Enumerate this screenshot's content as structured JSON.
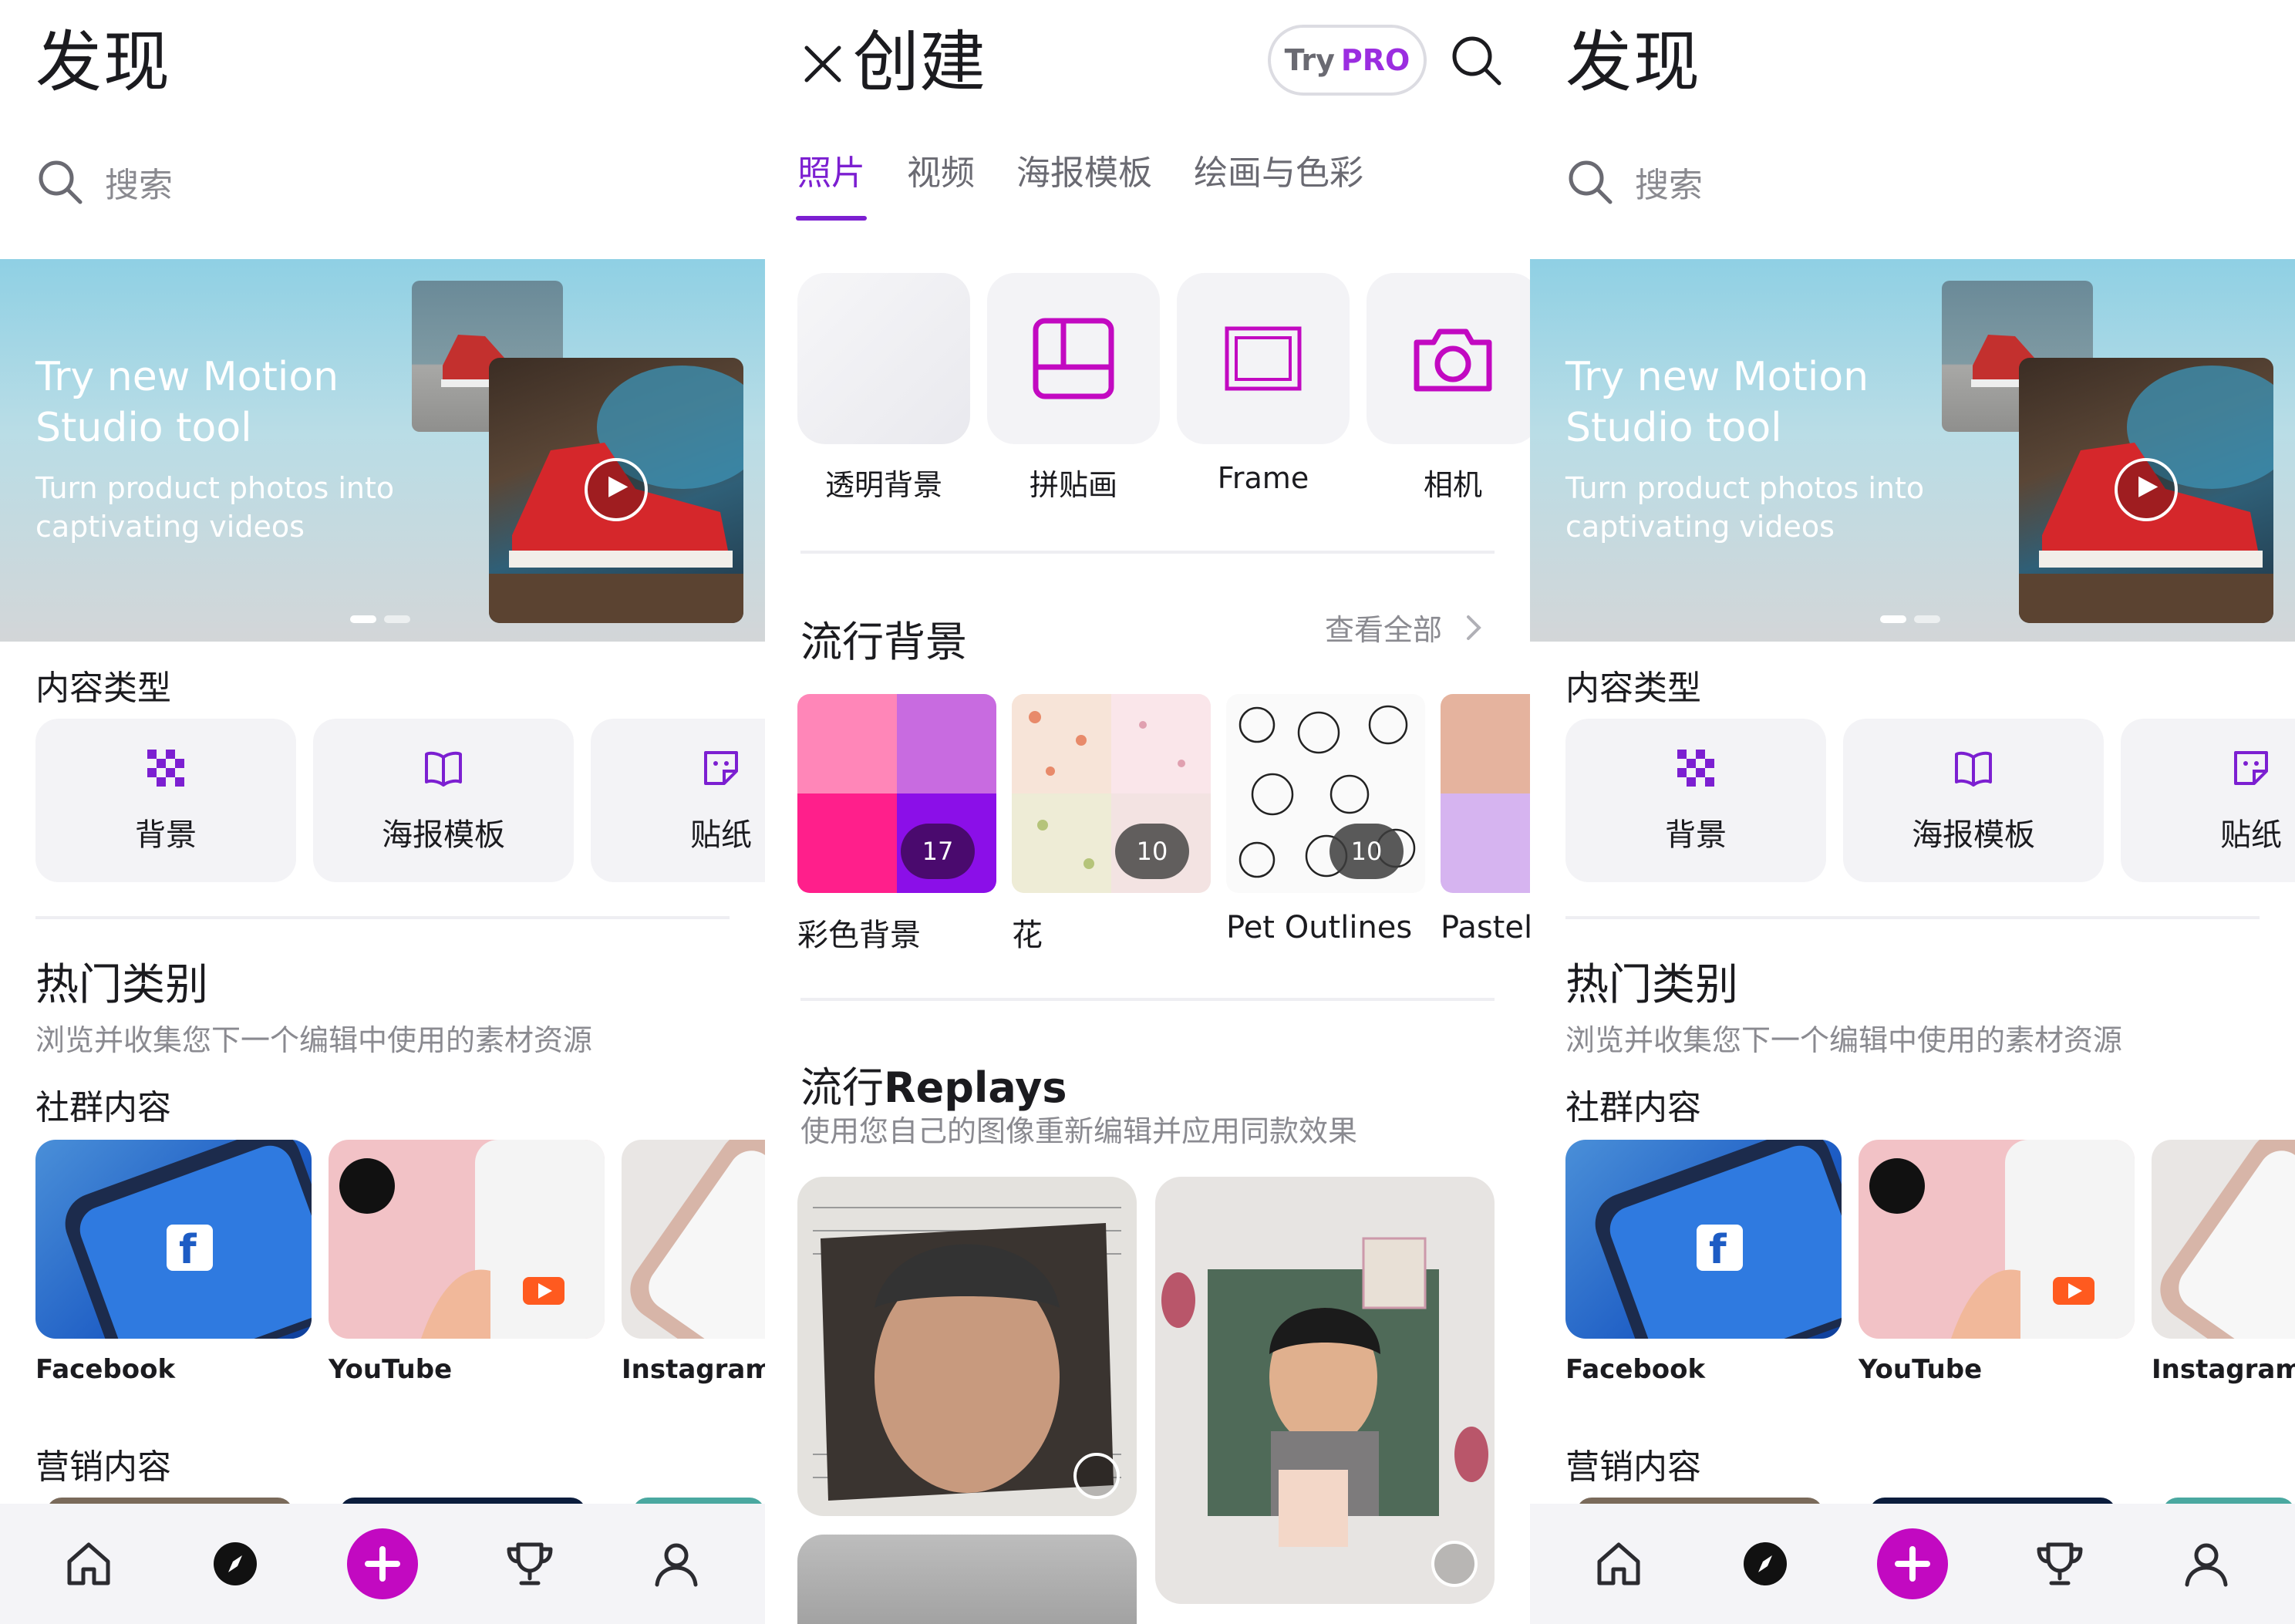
{
  "discover": {
    "title": "发现",
    "search_placeholder": "搜索",
    "banner": {
      "headline": "Try new Motion Studio tool",
      "subtitle": "Turn product photos into captivating videos"
    },
    "content_type": {
      "heading": "内容类型",
      "items": [
        {
          "label": "背景",
          "icon": "checker-icon"
        },
        {
          "label": "海报模板",
          "icon": "book-icon"
        },
        {
          "label": "贴纸",
          "icon": "sticker-icon"
        }
      ]
    },
    "hot": {
      "title": "热门类别",
      "subtitle": "浏览并收集您下一个编辑中使用的素材资源"
    },
    "community": {
      "heading": "社群内容",
      "items": [
        {
          "label": "Facebook"
        },
        {
          "label": "YouTube"
        },
        {
          "label": "Instagram"
        }
      ]
    },
    "marketing": {
      "heading": "营销内容"
    }
  },
  "bottom_nav": {
    "items": [
      "home-icon",
      "discover-icon",
      "create-plus-icon",
      "trophy-icon",
      "profile-icon"
    ]
  },
  "create": {
    "title": "创建",
    "try_pro": {
      "try": "Try",
      "pro": "PRO"
    },
    "tabs": [
      "照片",
      "视频",
      "海报模板",
      "绘画与色彩"
    ],
    "active_tab": 0,
    "tools": [
      {
        "label": "透明背景",
        "icon": "transparent-bg-icon"
      },
      {
        "label": "拼贴画",
        "icon": "collage-icon"
      },
      {
        "label": "Frame",
        "icon": "frame-icon"
      },
      {
        "label": "相机",
        "icon": "camera-icon"
      }
    ],
    "trending_bg": {
      "title": "流行背景",
      "see_all": "查看全部",
      "items": [
        {
          "label": "彩色背景",
          "count": "17"
        },
        {
          "label": "花",
          "count": "10"
        },
        {
          "label": "Pet Outlines",
          "count": "10"
        },
        {
          "label": "Pastel",
          "count": ""
        }
      ]
    },
    "replays": {
      "title_prefix": "流行",
      "title_bold": "Replays",
      "subtitle": "使用您自己的图像重新编辑并应用同款效果"
    }
  },
  "colors": {
    "accent": "#c209c1",
    "tab_active": "#7c1fd1",
    "pro": "#9b2de0",
    "text": "#1b1b1f",
    "muted": "#8a8a90"
  }
}
